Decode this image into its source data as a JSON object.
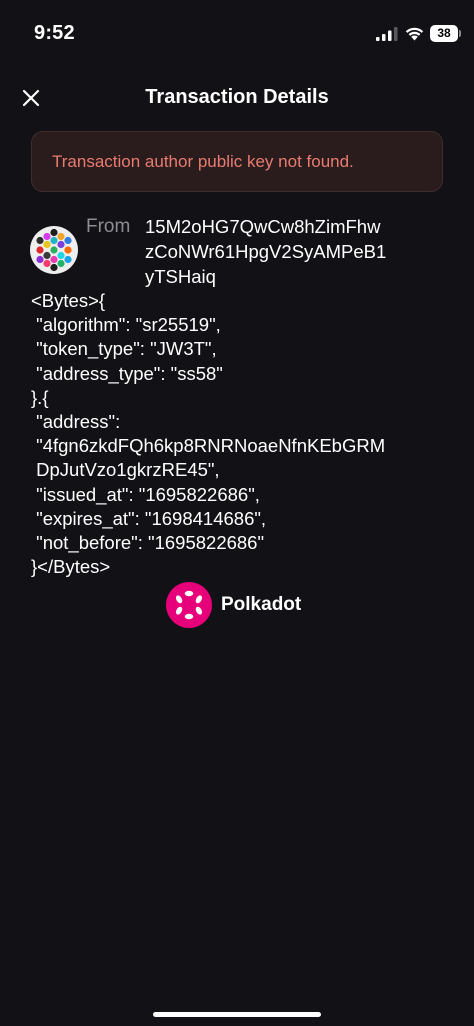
{
  "status_bar": {
    "time": "9:52",
    "battery": "38",
    "icons": [
      "signal-icon",
      "wifi-icon",
      "battery-icon"
    ]
  },
  "header": {
    "title": "Transaction Details",
    "close_icon": "close-icon"
  },
  "error": {
    "message": "Transaction author public key not found.",
    "color": "#ea7b71"
  },
  "sender": {
    "label": "From",
    "address_lines": [
      "15M2oHG7QwCw8hZimFhw",
      "zCoNWr61HpgV2SyAMPeB1",
      "yTSHaiq"
    ]
  },
  "message_lines": [
    "<Bytes>{",
    " \"algorithm\": \"sr25519\",",
    " \"token_type\": \"JW3T\",",
    " \"address_type\": \"ss58\"",
    "}.{",
    " \"address\":",
    " \"4fgn6zkdFQh6kp8RNRNoaeNfnKEbGRM",
    " DpJutVzo1gkrzRE45\",",
    " \"issued_at\": \"1695822686\",",
    " \"expires_at\": \"1698414686\",",
    " \"not_before\": \"1695822686\"",
    "}</Bytes>"
  ],
  "network": {
    "name": "Polkadot",
    "icon": "polkadot-icon",
    "brand_color": "#e6007a"
  },
  "colors": {
    "background": "#121116",
    "error_background": "#2a1c1d"
  }
}
